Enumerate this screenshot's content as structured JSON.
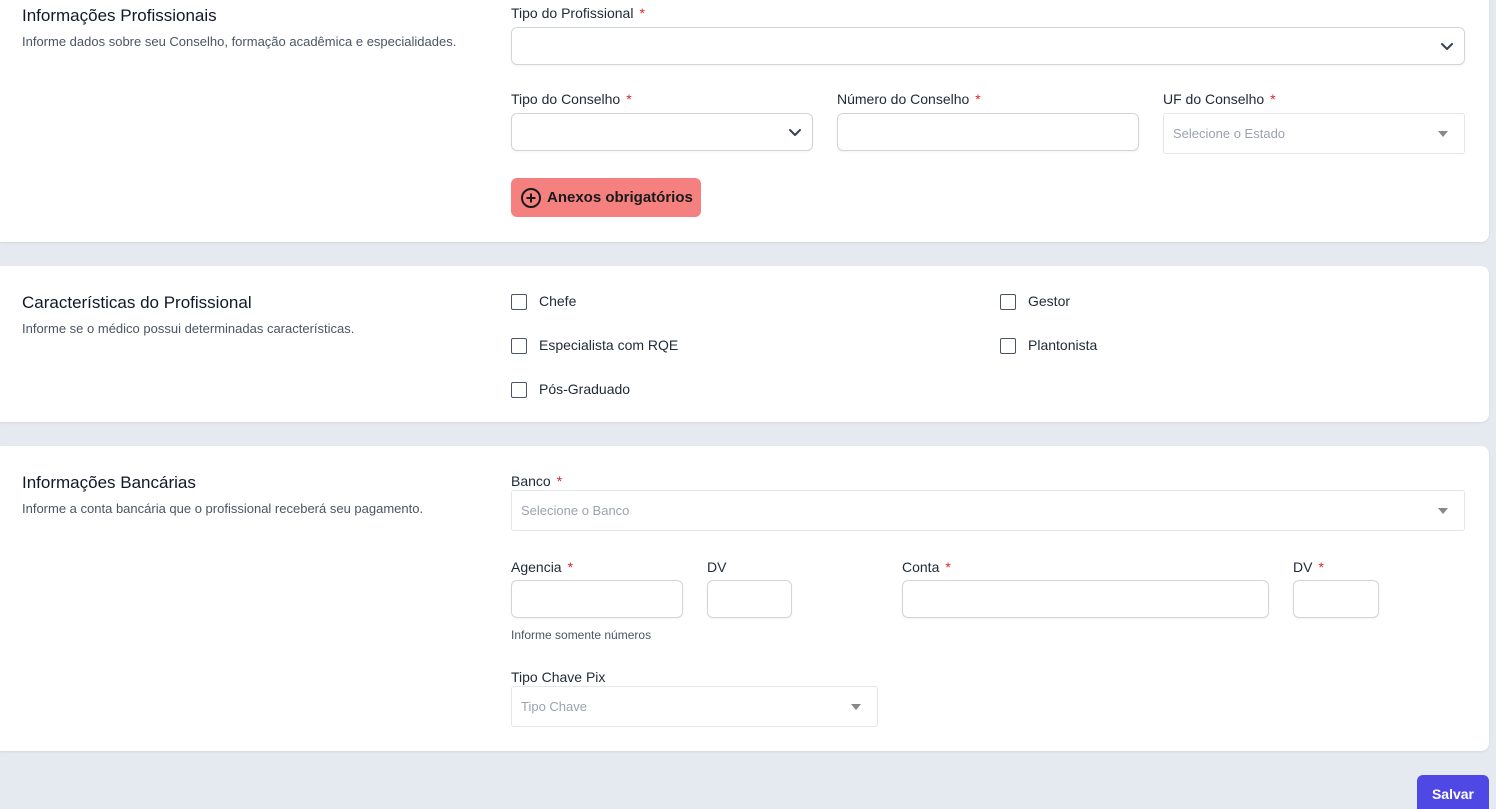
{
  "professional_info": {
    "title": "Informações Profissionais",
    "description": "Informe dados sobre seu Conselho, formação acadêmica e especialidades.",
    "tipo_profissional_label": "Tipo do Profissional",
    "tipo_conselho_label": "Tipo do Conselho",
    "numero_conselho_label": "Número do Conselho",
    "uf_conselho_label": "UF do Conselho",
    "uf_placeholder": "Selecione o Estado",
    "anexos_button": "Anexos obrigatórios",
    "required_mark": "*"
  },
  "characteristics": {
    "title": "Características do Profissional",
    "description": "Informe se o médico possui determinadas características.",
    "options": [
      "Chefe",
      "Gestor",
      "Especialista com RQE",
      "Plantonista",
      "Pós-Graduado"
    ]
  },
  "bank_info": {
    "title": "Informações Bancárias",
    "description": "Informe a conta bancária que o profissional receberá seu pagamento.",
    "banco_label": "Banco",
    "banco_placeholder": "Selecione o Banco",
    "agencia_label": "Agencia",
    "agencia_dv_label": "DV",
    "conta_label": "Conta",
    "conta_dv_label": "DV",
    "agencia_help": "Informe somente números",
    "pix_label": "Tipo Chave Pix",
    "pix_placeholder": "Tipo Chave"
  },
  "actions": {
    "save_label": "Salvar"
  },
  "colors": {
    "anexos_button_bg": "#f58080",
    "save_button_bg": "#5048e5",
    "required": "#dc2626",
    "page_bg": "#e5e9f0"
  }
}
